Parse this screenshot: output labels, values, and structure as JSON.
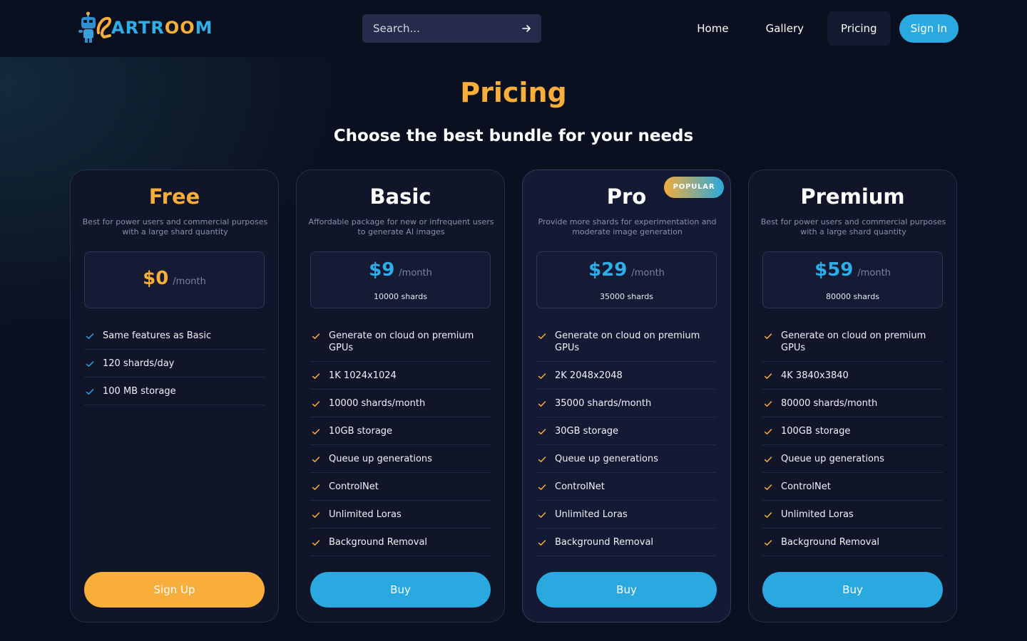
{
  "header": {
    "brand": {
      "text_main": "ARTR",
      "text_accent": "OO",
      "text_end": "M"
    },
    "search": {
      "placeholder": "Search..."
    },
    "nav": {
      "home": "Home",
      "gallery": "Gallery",
      "pricing": "Pricing",
      "signin": "Sign In"
    }
  },
  "page": {
    "title": "Pricing",
    "subtitle": "Choose the best bundle for your needs"
  },
  "colors": {
    "accent_orange": "#f9ad3a",
    "accent_blue": "#2aa8e0",
    "background": "#0b1020"
  },
  "plans": [
    {
      "name": "Free",
      "description": "Best for power users and commercial purposes with a large shard quantity",
      "price": "$0",
      "per": "/month",
      "shards": "",
      "check_color": "#2aa8e0",
      "features": [
        "Same features as Basic",
        "120 shards/day",
        "100 MB storage"
      ],
      "cta": "Sign Up"
    },
    {
      "name": "Basic",
      "description": "Affordable package for new or infrequent users to generate AI images",
      "price": "$9",
      "per": "/month",
      "shards": "10000 shards",
      "check_color": "#f9ad3a",
      "features": [
        "Generate on cloud on premium GPUs",
        "1K 1024x1024",
        "10000 shards/month",
        "10GB storage",
        "Queue up generations",
        "ControlNet",
        "Unlimited Loras",
        "Background Removal"
      ],
      "cta": "Buy"
    },
    {
      "name": "Pro",
      "badge": "POPULAR",
      "description": "Provide more shards for experimentation and moderate image generation",
      "price": "$29",
      "per": "/month",
      "shards": "35000 shards",
      "check_color": "#f9ad3a",
      "features": [
        "Generate on cloud on premium GPUs",
        "2K 2048x2048",
        "35000 shards/month",
        "30GB storage",
        "Queue up generations",
        "ControlNet",
        "Unlimited Loras",
        "Background Removal"
      ],
      "cta": "Buy"
    },
    {
      "name": "Premium",
      "description": "Best for power users and commercial purposes with a large shard quantity",
      "price": "$59",
      "per": "/month",
      "shards": "80000 shards",
      "check_color": "#f9ad3a",
      "features": [
        "Generate on cloud on premium GPUs",
        "4K 3840x3840",
        "80000 shards/month",
        "100GB storage",
        "Queue up generations",
        "ControlNet",
        "Unlimited Loras",
        "Background Removal"
      ],
      "cta": "Buy"
    }
  ]
}
